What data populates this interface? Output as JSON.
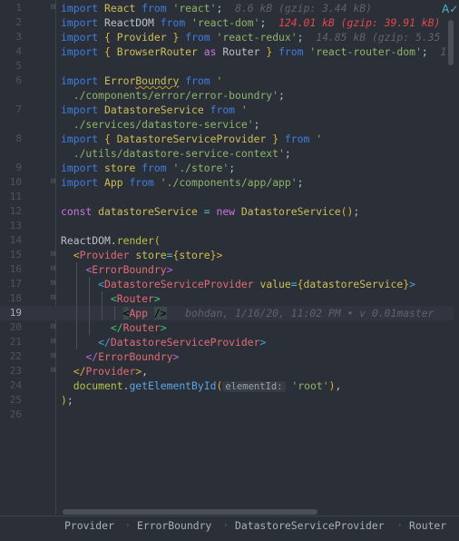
{
  "editor": {
    "current_line": 19,
    "rows": [
      {
        "n": "1",
        "fold": "open",
        "tokens": [
          [
            "kw",
            "import "
          ],
          [
            "id",
            "React "
          ],
          [
            "kw",
            "from "
          ],
          [
            "str",
            "'react'"
          ],
          [
            "pl",
            ";  "
          ],
          [
            "cm",
            "8.6 kB (gzip: 3.44 kB)"
          ]
        ]
      },
      {
        "n": "2",
        "tokens": [
          [
            "kw",
            "import "
          ],
          [
            "pl",
            "ReactDOM "
          ],
          [
            "kw",
            "from "
          ],
          [
            "str",
            "'react-dom'"
          ],
          [
            "pl",
            ";  "
          ],
          [
            "err",
            "124.01 kB (gzip: 39.91 kB)"
          ]
        ]
      },
      {
        "n": "3",
        "tokens": [
          [
            "kw",
            "import "
          ],
          [
            "by",
            "{ "
          ],
          [
            "id",
            "Provider "
          ],
          [
            "by",
            "} "
          ],
          [
            "kw",
            "from "
          ],
          [
            "str",
            "'react-redux'"
          ],
          [
            "pl",
            ";  "
          ],
          [
            "cm",
            "14.85 kB (gzip: 5.35"
          ]
        ]
      },
      {
        "n": "4",
        "tokens": [
          [
            "kw",
            "import "
          ],
          [
            "by",
            "{ "
          ],
          [
            "id",
            "BrowserRouter "
          ],
          [
            "pu",
            "as "
          ],
          [
            "pl",
            "Router "
          ],
          [
            "by",
            "} "
          ],
          [
            "kw",
            "from "
          ],
          [
            "str",
            "'react-router-dom'"
          ],
          [
            "pl",
            ";  "
          ],
          [
            "cm",
            "1"
          ]
        ]
      },
      {
        "n": "5",
        "tokens": []
      },
      {
        "n": "6",
        "tokens": [
          [
            "kw",
            "import "
          ],
          [
            "id",
            "Error"
          ],
          [
            "squig",
            "Boundry"
          ],
          [
            "pl",
            " "
          ],
          [
            "kw",
            "from "
          ],
          [
            "str",
            "'"
          ]
        ]
      },
      {
        "n": "",
        "tokens": [
          [
            "str",
            "  ./components/error/error-boundry'"
          ],
          [
            "pl",
            ";"
          ]
        ]
      },
      {
        "n": "7",
        "tokens": [
          [
            "kw",
            "import "
          ],
          [
            "id",
            "DatastoreService "
          ],
          [
            "kw",
            "from "
          ],
          [
            "str",
            "'"
          ]
        ]
      },
      {
        "n": "",
        "tokens": [
          [
            "str",
            "  ./services/datastore-service'"
          ],
          [
            "pl",
            ";"
          ]
        ]
      },
      {
        "n": "8",
        "tokens": [
          [
            "kw",
            "import "
          ],
          [
            "by",
            "{ "
          ],
          [
            "id",
            "DatastoreServiceProvider "
          ],
          [
            "by",
            "} "
          ],
          [
            "kw",
            "from "
          ],
          [
            "str",
            "'"
          ]
        ]
      },
      {
        "n": "",
        "tokens": [
          [
            "str",
            "  ./utils/datastore-service-context'"
          ],
          [
            "pl",
            ";"
          ]
        ]
      },
      {
        "n": "9",
        "tokens": [
          [
            "kw",
            "import "
          ],
          [
            "id",
            "store "
          ],
          [
            "kw",
            "from "
          ],
          [
            "str",
            "'./store'"
          ],
          [
            "pl",
            ";"
          ]
        ]
      },
      {
        "n": "10",
        "fold": "close",
        "tokens": [
          [
            "kw",
            "import "
          ],
          [
            "id",
            "App "
          ],
          [
            "kw",
            "from "
          ],
          [
            "str",
            "'./components/app/app'"
          ],
          [
            "pl",
            ";"
          ]
        ]
      },
      {
        "n": "11",
        "tokens": []
      },
      {
        "n": "12",
        "tokens": [
          [
            "pu",
            "const "
          ],
          [
            "id",
            "datastoreService "
          ],
          [
            "op",
            "= "
          ],
          [
            "pu",
            "new "
          ],
          [
            "id",
            "DatastoreService"
          ],
          [
            "by",
            "()"
          ],
          [
            "pl",
            ";"
          ]
        ]
      },
      {
        "n": "13",
        "tokens": []
      },
      {
        "n": "14",
        "tokens": [
          [
            "pl",
            "ReactDOM."
          ],
          [
            "fn",
            "render"
          ],
          [
            "by",
            "("
          ]
        ]
      },
      {
        "n": "15",
        "fold": "open",
        "tokens": [
          [
            "pl",
            "  "
          ],
          [
            "by",
            "<"
          ],
          [
            "tag",
            "Provider "
          ],
          [
            "id",
            "store"
          ],
          [
            "op",
            "="
          ],
          [
            "by",
            "{"
          ],
          [
            "id",
            "store"
          ],
          [
            "by",
            "}>"
          ]
        ]
      },
      {
        "n": "16",
        "fold": "open",
        "tokens": [
          [
            "pl",
            "    "
          ],
          [
            "bp",
            "<"
          ],
          [
            "tag",
            "ErrorBoundry"
          ],
          [
            "bp",
            ">"
          ]
        ]
      },
      {
        "n": "17",
        "fold": "open",
        "tokens": [
          [
            "pl",
            "      "
          ],
          [
            "bb",
            "<"
          ],
          [
            "tag",
            "DatastoreServiceProvider "
          ],
          [
            "id",
            "value"
          ],
          [
            "op",
            "="
          ],
          [
            "by",
            "{"
          ],
          [
            "id",
            "datastoreService"
          ],
          [
            "by",
            "}"
          ],
          [
            "bb",
            ">"
          ]
        ]
      },
      {
        "n": "18",
        "fold": "open",
        "tokens": [
          [
            "pl",
            "        "
          ],
          [
            "bg",
            "<"
          ],
          [
            "tag",
            "Router"
          ],
          [
            "bg",
            ">"
          ]
        ]
      },
      {
        "n": "19",
        "tokens": [
          [
            "pl",
            "          "
          ],
          [
            "hl",
            "<"
          ],
          [
            "tag",
            "App "
          ],
          [
            "hl",
            "/>"
          ],
          [
            "pl",
            "   "
          ],
          [
            "cm",
            "bohdan, 1/16/20, 11:02 PM • v 0.01master"
          ]
        ]
      },
      {
        "n": "20",
        "fold": "close",
        "tokens": [
          [
            "pl",
            "        "
          ],
          [
            "bg",
            "</"
          ],
          [
            "tag",
            "Router"
          ],
          [
            "bg",
            ">"
          ]
        ]
      },
      {
        "n": "21",
        "fold": "close",
        "tokens": [
          [
            "pl",
            "      "
          ],
          [
            "bb",
            "</"
          ],
          [
            "tag",
            "DatastoreServiceProvider"
          ],
          [
            "bb",
            ">"
          ]
        ]
      },
      {
        "n": "22",
        "fold": "close",
        "tokens": [
          [
            "pl",
            "    "
          ],
          [
            "bp",
            "</"
          ],
          [
            "tag",
            "ErrorBoundry"
          ],
          [
            "bp",
            ">"
          ]
        ]
      },
      {
        "n": "23",
        "fold": "close",
        "tokens": [
          [
            "pl",
            "  "
          ],
          [
            "by",
            "</"
          ],
          [
            "tag",
            "Provider"
          ],
          [
            "by",
            ">"
          ],
          [
            "pl",
            ","
          ]
        ]
      },
      {
        "n": "24",
        "tokens": [
          [
            "pl",
            "  "
          ],
          [
            "fn",
            "document"
          ],
          [
            "pl",
            "."
          ],
          [
            "me",
            "getElementById"
          ],
          [
            "by",
            "("
          ],
          [
            "hint",
            "elementId:"
          ],
          [
            "pl",
            " "
          ],
          [
            "str",
            "'root'"
          ],
          [
            "by",
            ")"
          ],
          [
            "pl",
            ","
          ]
        ]
      },
      {
        "n": "25",
        "tokens": [
          [
            "by",
            ")"
          ],
          [
            "pl",
            ";"
          ]
        ]
      },
      {
        "n": "26",
        "tokens": []
      }
    ]
  },
  "spellcheck_icon": "spellcheck-icon",
  "breadcrumbs": [
    "Provider",
    "ErrorBoundry",
    "DatastoreServiceProvider",
    "Router"
  ]
}
